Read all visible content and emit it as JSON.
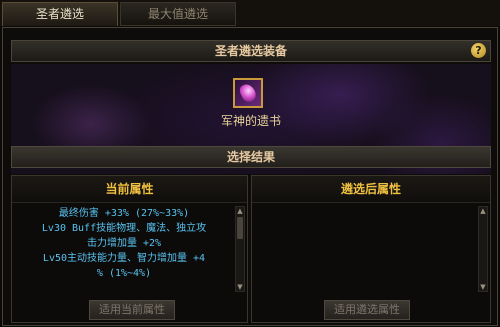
{
  "tabs": [
    {
      "label": "圣者遴选"
    },
    {
      "label": "最大值遴选"
    }
  ],
  "header": {
    "title": "圣者遴选装备",
    "help": "?"
  },
  "item": {
    "name": "军神的遗书",
    "icon": "purple-gem-book-icon"
  },
  "result": {
    "title": "选择结果"
  },
  "current": {
    "title": "当前属性",
    "attributes": [
      {
        "text": "最终伤害 +33% (27%~33%)"
      },
      {
        "text": "Lv30 Buff技能物理、魔法、独立攻",
        "cont": "击力增加量 +2%"
      },
      {
        "text": "Lv50主动技能力量、智力增加量 +4",
        "cont": "% (1%~4%)"
      }
    ],
    "button": "适用当前属性"
  },
  "selected": {
    "title": "遴选后属性",
    "button": "适用遴选属性"
  },
  "colors": {
    "accent_gold": "#f0c040",
    "attr_blue": "#58c2f0",
    "title_tan": "#e6c9a0"
  }
}
